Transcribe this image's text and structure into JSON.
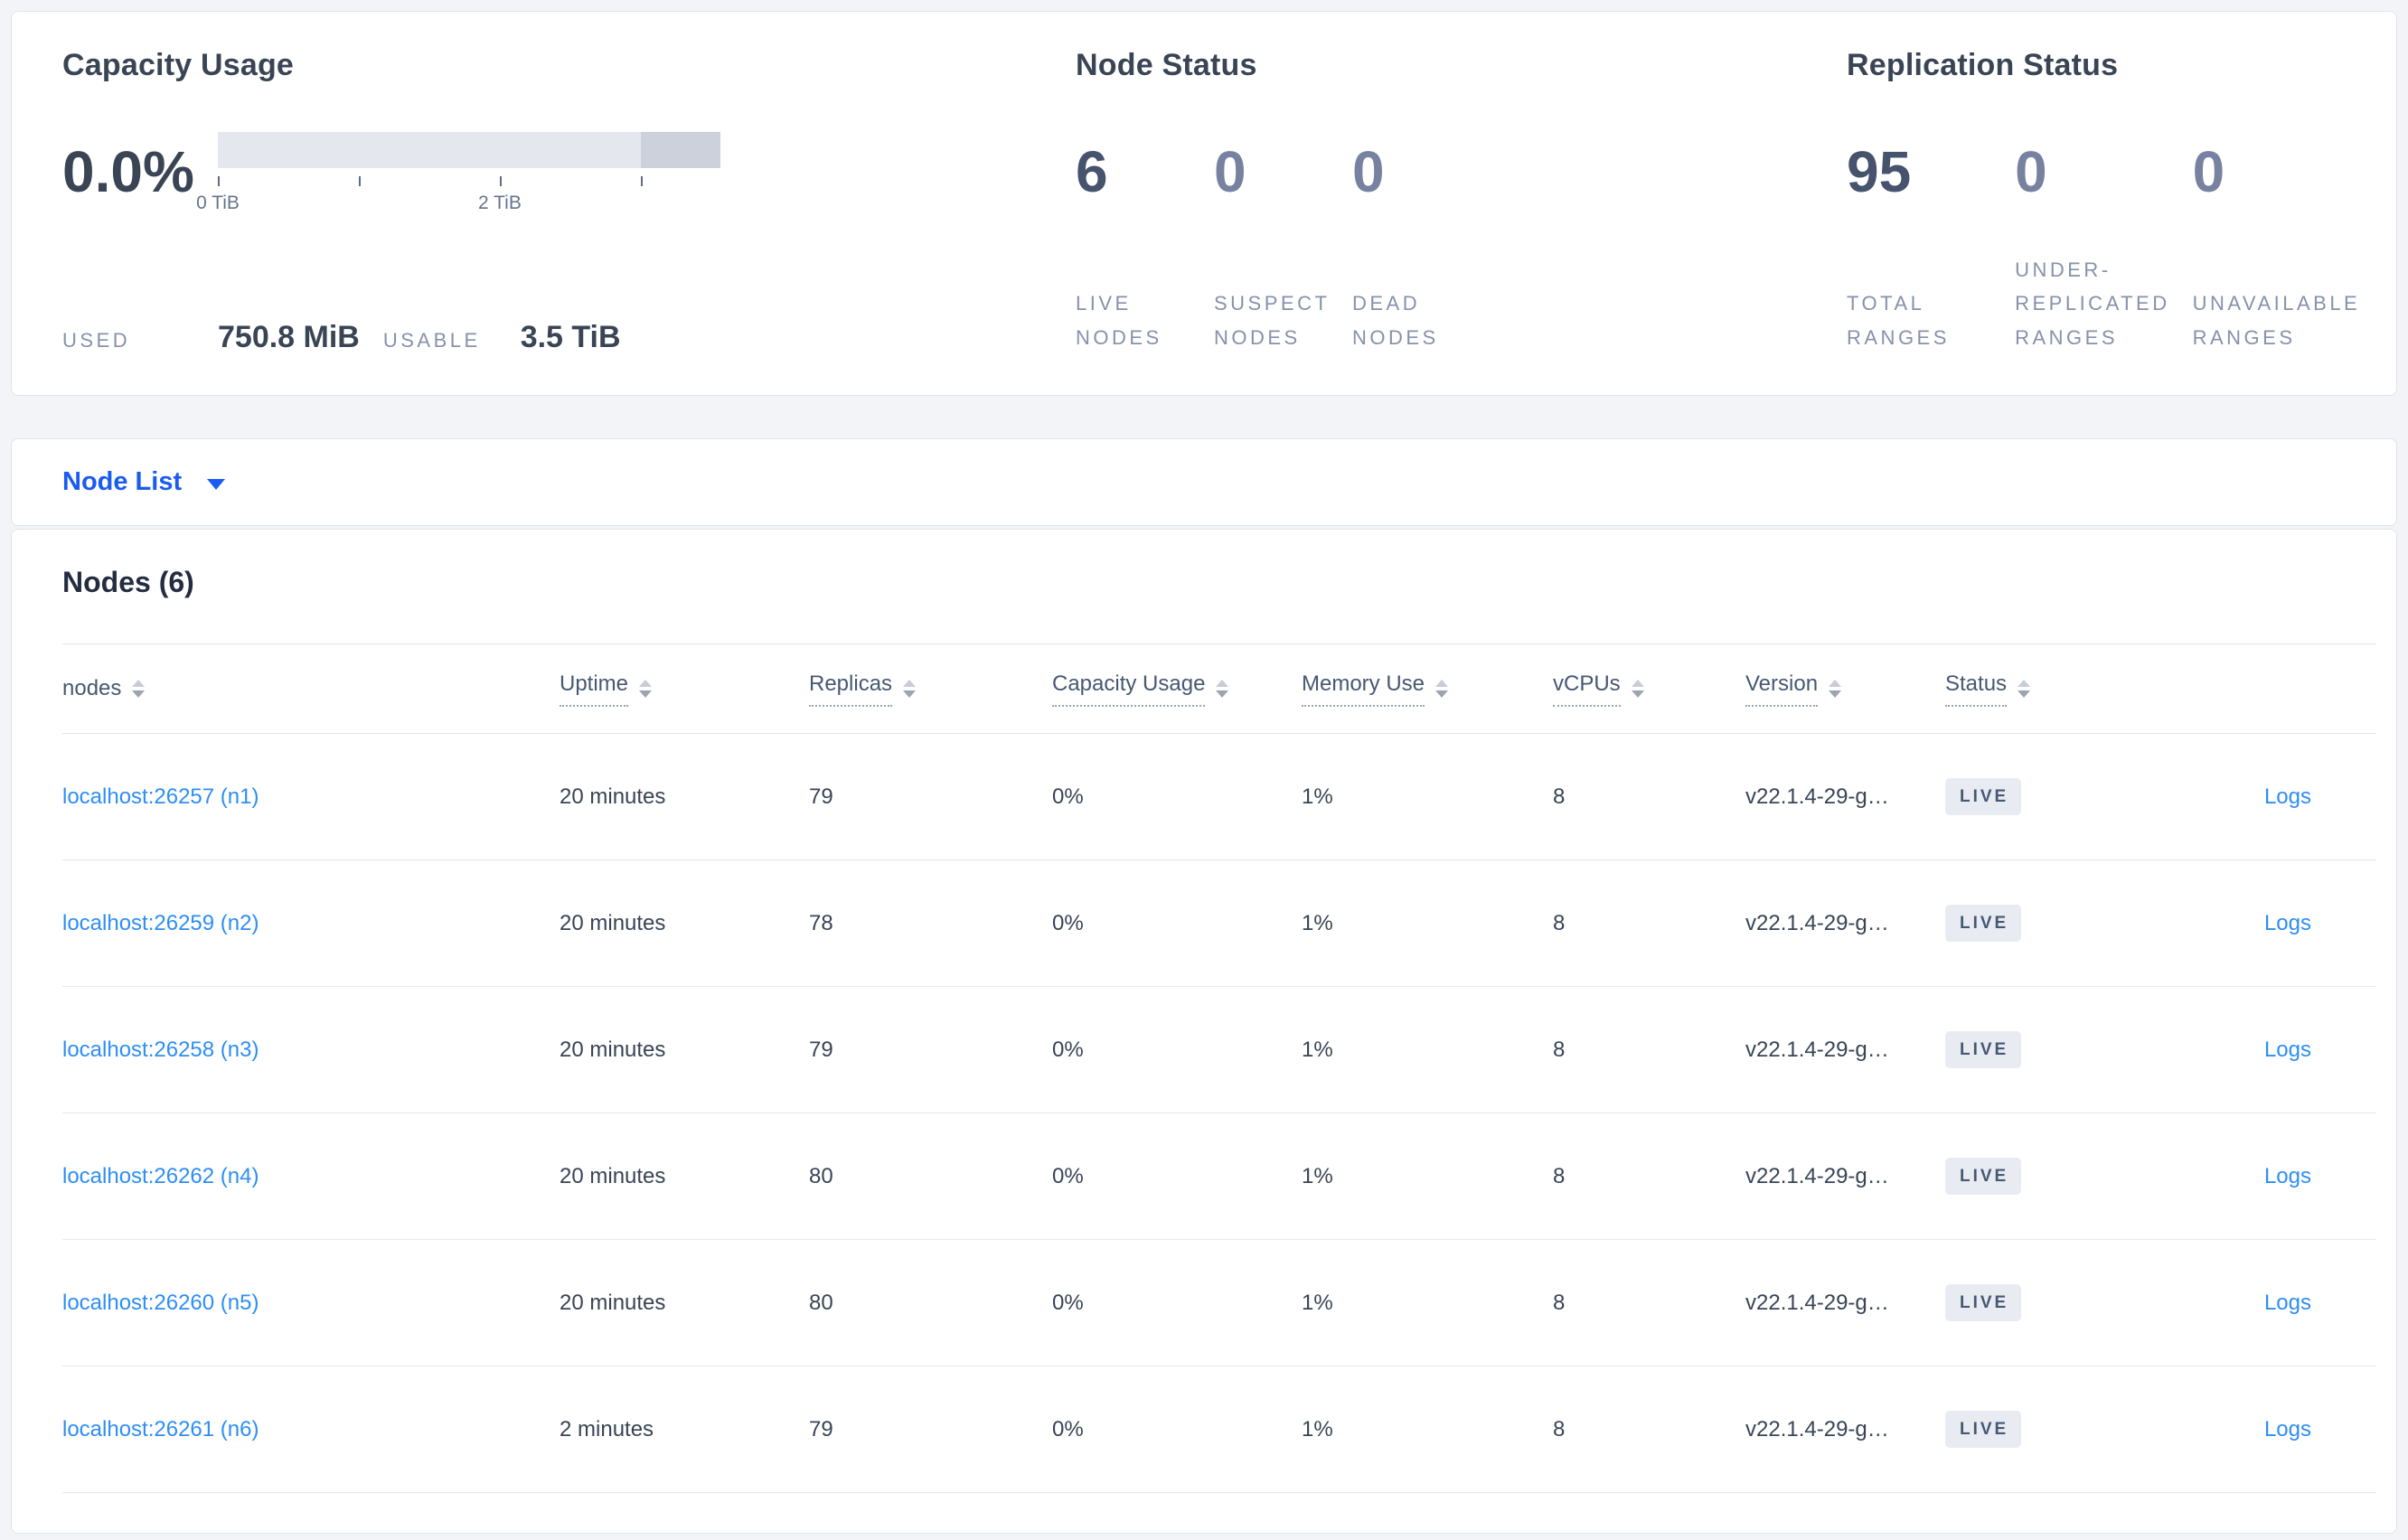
{
  "colors": {
    "primary_blue": "#1a5cf0",
    "link_blue": "#2e8ef3",
    "heading_dark": "#394455",
    "stat_muted": "#7682a0",
    "caps_label": "#8691ab",
    "badge_bg": "#e8ecf2",
    "bar_track": "#e4e7ee",
    "bar_segment": "#ccd1db",
    "page_bg": "#f2f4f8"
  },
  "summary": {
    "capacity": {
      "title": "Capacity Usage",
      "percent": "0.0%",
      "tick_labels": [
        "0 TiB",
        "2 TiB"
      ],
      "tick_positions_pct": [
        0,
        28.06,
        56.1,
        84.2
      ],
      "bar_total": "3.5 TiB",
      "used_label": "USED",
      "used_value": "750.8 MiB",
      "usable_label": "USABLE",
      "usable_value": "3.5 TiB"
    },
    "node_status": {
      "title": "Node Status",
      "stats": [
        {
          "value": "6",
          "label": "LIVE NODES",
          "muted": false
        },
        {
          "value": "0",
          "label": "SUSPECT NODES",
          "muted": true
        },
        {
          "value": "0",
          "label": "DEAD NODES",
          "muted": true
        }
      ]
    },
    "replication": {
      "title": "Replication Status",
      "stats": [
        {
          "value": "95",
          "label": "TOTAL RANGES",
          "muted": false
        },
        {
          "value": "0",
          "label": "UNDER-REPLICATED RANGES",
          "muted": true
        },
        {
          "value": "0",
          "label": "UNAVAILABLE RANGES",
          "muted": true
        }
      ]
    }
  },
  "view_selector": {
    "label": "Node List"
  },
  "table": {
    "title": "Nodes (6)",
    "columns": [
      {
        "key": "address",
        "label": "nodes",
        "dotted": false
      },
      {
        "key": "uptime",
        "label": "Uptime",
        "dotted": true
      },
      {
        "key": "replicas",
        "label": "Replicas",
        "dotted": true
      },
      {
        "key": "capacity",
        "label": "Capacity Usage",
        "dotted": true
      },
      {
        "key": "memory",
        "label": "Memory Use",
        "dotted": true
      },
      {
        "key": "vcpus",
        "label": "vCPUs",
        "dotted": true
      },
      {
        "key": "version",
        "label": "Version",
        "dotted": true
      },
      {
        "key": "status",
        "label": "Status",
        "dotted": true
      },
      {
        "key": "logs",
        "label": "",
        "dotted": false
      }
    ],
    "rows": [
      {
        "address": "localhost:26257 (n1)",
        "uptime": "20 minutes",
        "replicas": "79",
        "capacity": "0%",
        "memory": "1%",
        "vcpus": "8",
        "version": "v22.1.4-29-g…",
        "status": "LIVE",
        "logs": "Logs"
      },
      {
        "address": "localhost:26259 (n2)",
        "uptime": "20 minutes",
        "replicas": "78",
        "capacity": "0%",
        "memory": "1%",
        "vcpus": "8",
        "version": "v22.1.4-29-g…",
        "status": "LIVE",
        "logs": "Logs"
      },
      {
        "address": "localhost:26258 (n3)",
        "uptime": "20 minutes",
        "replicas": "79",
        "capacity": "0%",
        "memory": "1%",
        "vcpus": "8",
        "version": "v22.1.4-29-g…",
        "status": "LIVE",
        "logs": "Logs"
      },
      {
        "address": "localhost:26262 (n4)",
        "uptime": "20 minutes",
        "replicas": "80",
        "capacity": "0%",
        "memory": "1%",
        "vcpus": "8",
        "version": "v22.1.4-29-g…",
        "status": "LIVE",
        "logs": "Logs"
      },
      {
        "address": "localhost:26260 (n5)",
        "uptime": "20 minutes",
        "replicas": "80",
        "capacity": "0%",
        "memory": "1%",
        "vcpus": "8",
        "version": "v22.1.4-29-g…",
        "status": "LIVE",
        "logs": "Logs"
      },
      {
        "address": "localhost:26261 (n6)",
        "uptime": "2 minutes",
        "replicas": "79",
        "capacity": "0%",
        "memory": "1%",
        "vcpus": "8",
        "version": "v22.1.4-29-g…",
        "status": "LIVE",
        "logs": "Logs"
      }
    ]
  }
}
